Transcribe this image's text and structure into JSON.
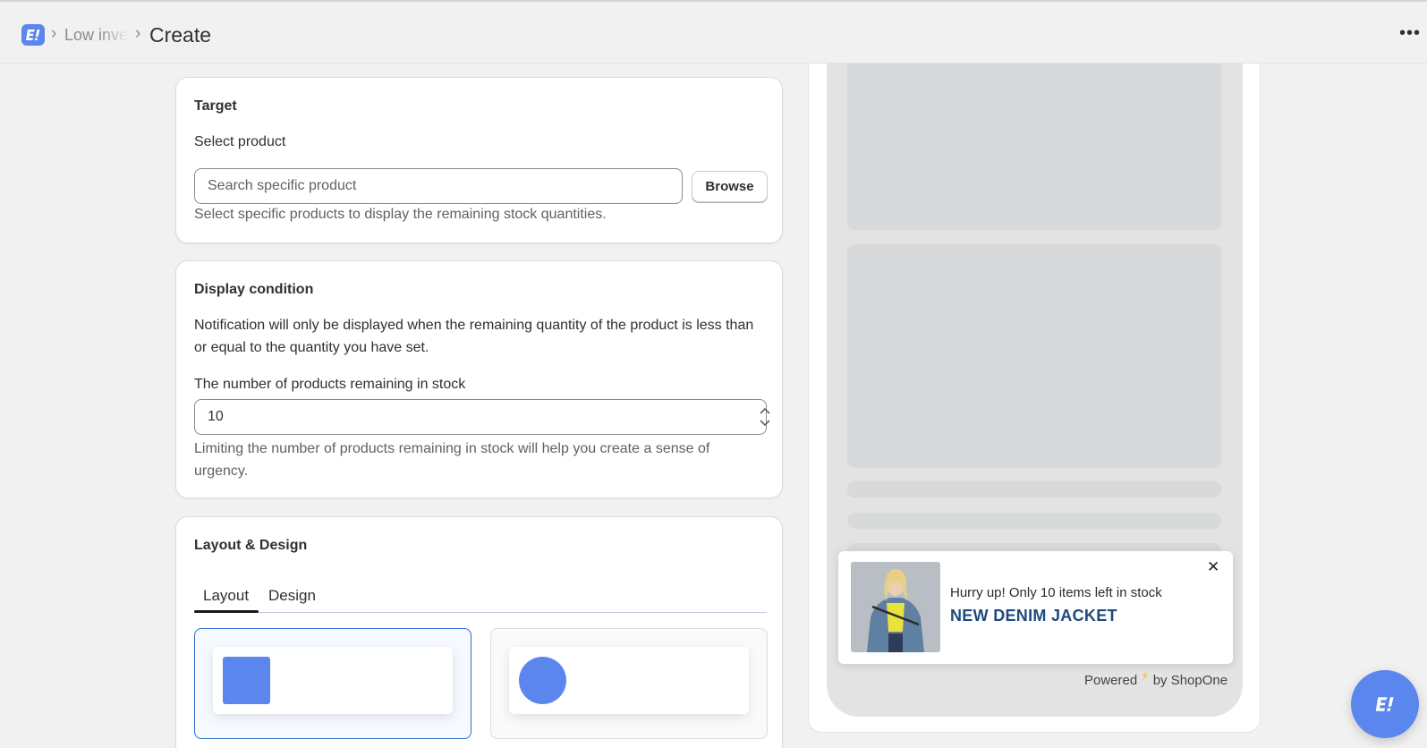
{
  "header": {
    "breadcrumb_parent": "Low inventory",
    "page_title": "Create",
    "more_label": "•••"
  },
  "target_card": {
    "title": "Target",
    "select_label": "Select product",
    "search_placeholder": "Search specific product",
    "search_value": "",
    "browse_label": "Browse",
    "help": "Select specific products to display the remaining stock quantities."
  },
  "display_condition": {
    "title": "Display condition",
    "description": "Notification will only be displayed when the remaining quantity of the product is less than or equal to the quantity you have set.",
    "quantity_label": "The number of products remaining in stock",
    "quantity_value": "10",
    "help": "Limiting the number of products remaining in stock will help you create a sense of urgency."
  },
  "layout_design": {
    "title": "Layout & Design",
    "tabs": [
      {
        "label": "Layout",
        "active": true
      },
      {
        "label": "Design",
        "active": false
      }
    ],
    "options": [
      {
        "shape": "square",
        "selected": true
      },
      {
        "shape": "circle",
        "selected": false
      }
    ]
  },
  "preview": {
    "message": "Hurry up! Only 10 items left in stock",
    "product_name": "NEW DENIM JACKET",
    "close_label": "✕",
    "powered_prefix": "Powered",
    "powered_suffix": "by ShopOne"
  },
  "colors": {
    "accent": "#5b86ee",
    "product_name": "#1e4a7e",
    "selected_border": "#2c6ecb",
    "bolt": "#f2b705"
  },
  "icons": {
    "app_logo": "shopone-logo-icon",
    "breadcrumb_separator": "chevron-right-icon",
    "stepper": "chevron-up-down-icon",
    "close": "close-icon",
    "powered": "lightning-bolt-icon",
    "chat_fab": "shopone-logo-icon"
  }
}
